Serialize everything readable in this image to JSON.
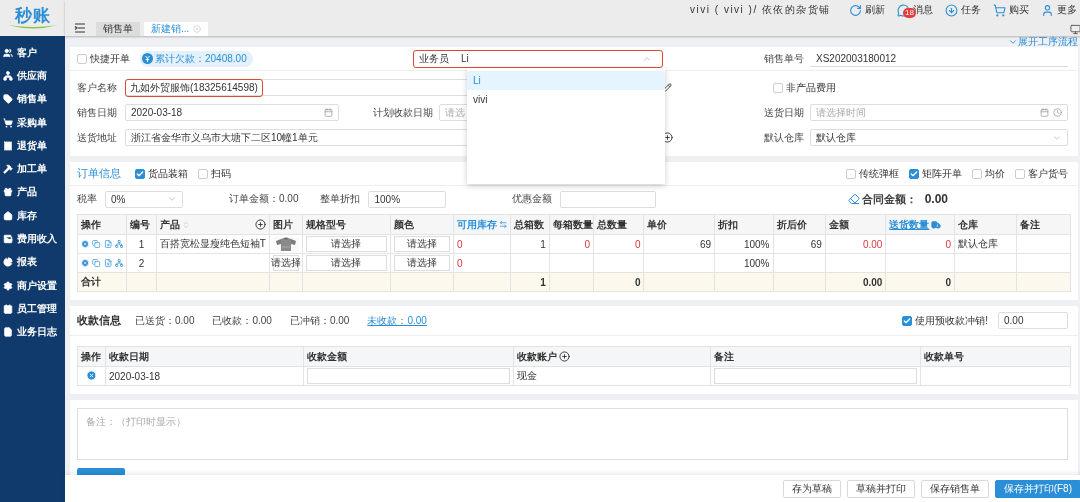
{
  "app": {
    "logo": "秒账"
  },
  "tabs": [
    {
      "label": "销售单",
      "selected": false
    },
    {
      "label": "新建销...",
      "selected": true
    }
  ],
  "header": {
    "user": "vivi ( vivi )/ 依依的杂货铺",
    "actions": [
      {
        "label": "刷新",
        "kind": "refresh"
      },
      {
        "label": "消息",
        "kind": "message",
        "badge": "18"
      },
      {
        "label": "任务",
        "kind": "task"
      },
      {
        "label": "购买",
        "kind": "cart"
      },
      {
        "label": "更多",
        "kind": "user"
      }
    ]
  },
  "sidebar": {
    "items": [
      {
        "label": "客户",
        "kind": "customers"
      },
      {
        "label": "供应商",
        "kind": "suppliers"
      },
      {
        "label": "销售单",
        "kind": "sales"
      },
      {
        "label": "采购单",
        "kind": "purchase"
      },
      {
        "label": "退货单",
        "kind": "returns"
      },
      {
        "label": "加工单",
        "kind": "processing"
      },
      {
        "label": "产品",
        "kind": "products"
      },
      {
        "label": "库存",
        "kind": "inventory"
      },
      {
        "label": "费用收入",
        "kind": "finance"
      },
      {
        "label": "报表",
        "kind": "reports"
      },
      {
        "label": "商户设置",
        "kind": "settings"
      },
      {
        "label": "员工管理",
        "kind": "staff"
      },
      {
        "label": "业务日志",
        "kind": "log"
      }
    ]
  },
  "workflow_link": "展开工序流程",
  "form": {
    "quick_order": {
      "label": "快捷开单",
      "checked": false
    },
    "debt_badge": "累计欠款：20408.00",
    "salesperson": {
      "label": "业务员",
      "value": "Li",
      "highlighted": true
    },
    "sales_no": {
      "label": "销售单号",
      "value": "XS202003180012"
    },
    "customer": {
      "label": "客户名称",
      "value": "九如外贸服饰(18325614598)",
      "highlighted": true
    },
    "non_product_fee": {
      "label": "非产品费用",
      "checked": false
    },
    "sale_date": {
      "label": "销售日期",
      "value": "2020-03-18"
    },
    "plan_date": {
      "label": "计划收款日期",
      "placeholder": "请选"
    },
    "delivery_date": {
      "label": "送货日期",
      "placeholder": "请选择时间"
    },
    "address": {
      "label": "送货地址",
      "value": "浙江省金华市义乌市大塘下二区10幢1单元"
    },
    "warehouse": {
      "label": "默认仓库",
      "value": "默认仓库"
    }
  },
  "salesperson_dropdown": {
    "options": [
      {
        "label": "Li",
        "selected": true
      },
      {
        "label": "vivi",
        "selected": false
      }
    ]
  },
  "order": {
    "title": "订单信息",
    "options": [
      {
        "label": "货品装箱",
        "checked": true
      },
      {
        "label": "扫码",
        "checked": false
      }
    ],
    "view_options": [
      {
        "label": "传统弹框",
        "checked": false
      },
      {
        "label": "矩阵开单",
        "checked": true
      },
      {
        "label": "均价",
        "checked": false
      },
      {
        "label": "客户货号",
        "checked": false
      }
    ],
    "tax": {
      "label": "税率",
      "value": "0%"
    },
    "order_amount": "订单金额：0.00",
    "discount": {
      "label": "整单折扣",
      "value": "100%"
    },
    "coupon": {
      "label": "优惠金额"
    },
    "contract_amount": {
      "label": "合同金额：",
      "value": "0.00"
    },
    "table": {
      "columns": [
        {
          "label": "操作",
          "kind": "ops"
        },
        {
          "label": "编号",
          "kind": "index"
        },
        {
          "label": "产品",
          "kind": "text",
          "sortable": true
        },
        {
          "label": "图片"
        },
        {
          "label": "规格型号",
          "kind": "select"
        },
        {
          "label": "颜色",
          "kind": "select"
        },
        {
          "label": "可用库存",
          "kind": "stock",
          "accent": true,
          "alert": true
        },
        {
          "label": "总箱数",
          "kind": "number",
          "alert": false
        },
        {
          "label": "每箱数量",
          "kind": "number",
          "alert": true
        },
        {
          "label": "总数量",
          "kind": "number",
          "alert": true
        },
        {
          "label": "单价",
          "kind": "number",
          "alert": false
        },
        {
          "label": "折扣",
          "kind": "number",
          "alert": false
        },
        {
          "label": "折后价",
          "kind": "number",
          "alert": false
        },
        {
          "label": "金额",
          "kind": "number",
          "alert": true
        },
        {
          "label": "送货数量",
          "kind": "number",
          "link": true,
          "alert": true
        },
        {
          "label": "仓库",
          "kind": "text"
        },
        {
          "label": "备注",
          "kind": "text"
        }
      ],
      "rows": [
        {
          "kind": "item",
          "cells": [
            "",
            "1",
            "百搭宽松显瘦纯色短袖T",
            {
              "kind": "picture"
            },
            "请选择",
            "请选择",
            "0",
            "1",
            "0",
            "0",
            "69",
            "100%",
            "69",
            "0.00",
            "0",
            "默认仓库",
            ""
          ]
        },
        {
          "kind": "item",
          "cells": [
            "",
            "2",
            "",
            "请选择",
            "请选择",
            "请选择",
            "0",
            "",
            "",
            "",
            "",
            "100%",
            "",
            "",
            "",
            "",
            ""
          ]
        },
        {
          "kind": "total",
          "cells": [
            "合计",
            "",
            "",
            "",
            "",
            "",
            "",
            "1",
            "",
            "0",
            "",
            "",
            "",
            "0.00",
            "0",
            "",
            ""
          ]
        }
      ]
    }
  },
  "payment": {
    "title": "收款信息",
    "stats": [
      "已送货：0.00",
      "已收款：0.00",
      "已冲销：0.00"
    ],
    "unpaid_link": "未收款：0.00",
    "prepaid": {
      "label": "使用预收款冲销!",
      "checked": true,
      "value": "0.00"
    },
    "table": {
      "columns": [
        {
          "label": "操作",
          "kind": "ops"
        },
        {
          "label": "收款日期",
          "kind": "text"
        },
        {
          "label": "收款金额",
          "kind": "input"
        },
        {
          "label": "收款账户",
          "kind": "account"
        },
        {
          "label": "备注",
          "kind": "input"
        },
        {
          "label": "收款单号",
          "kind": "text"
        }
      ],
      "rows": [
        {
          "cells": [
            "",
            "2020-03-18",
            "",
            "现金",
            "",
            ""
          ]
        }
      ]
    }
  },
  "remarks": {
    "placeholder": "备注：（打印时显示）"
  },
  "footer": {
    "buttons": [
      {
        "label": "存为草稿",
        "primary": false
      },
      {
        "label": "草稿并打印",
        "primary": false
      },
      {
        "label": "保存销售单",
        "primary": false
      },
      {
        "label": "保存并打印(F8)",
        "primary": true
      }
    ]
  }
}
